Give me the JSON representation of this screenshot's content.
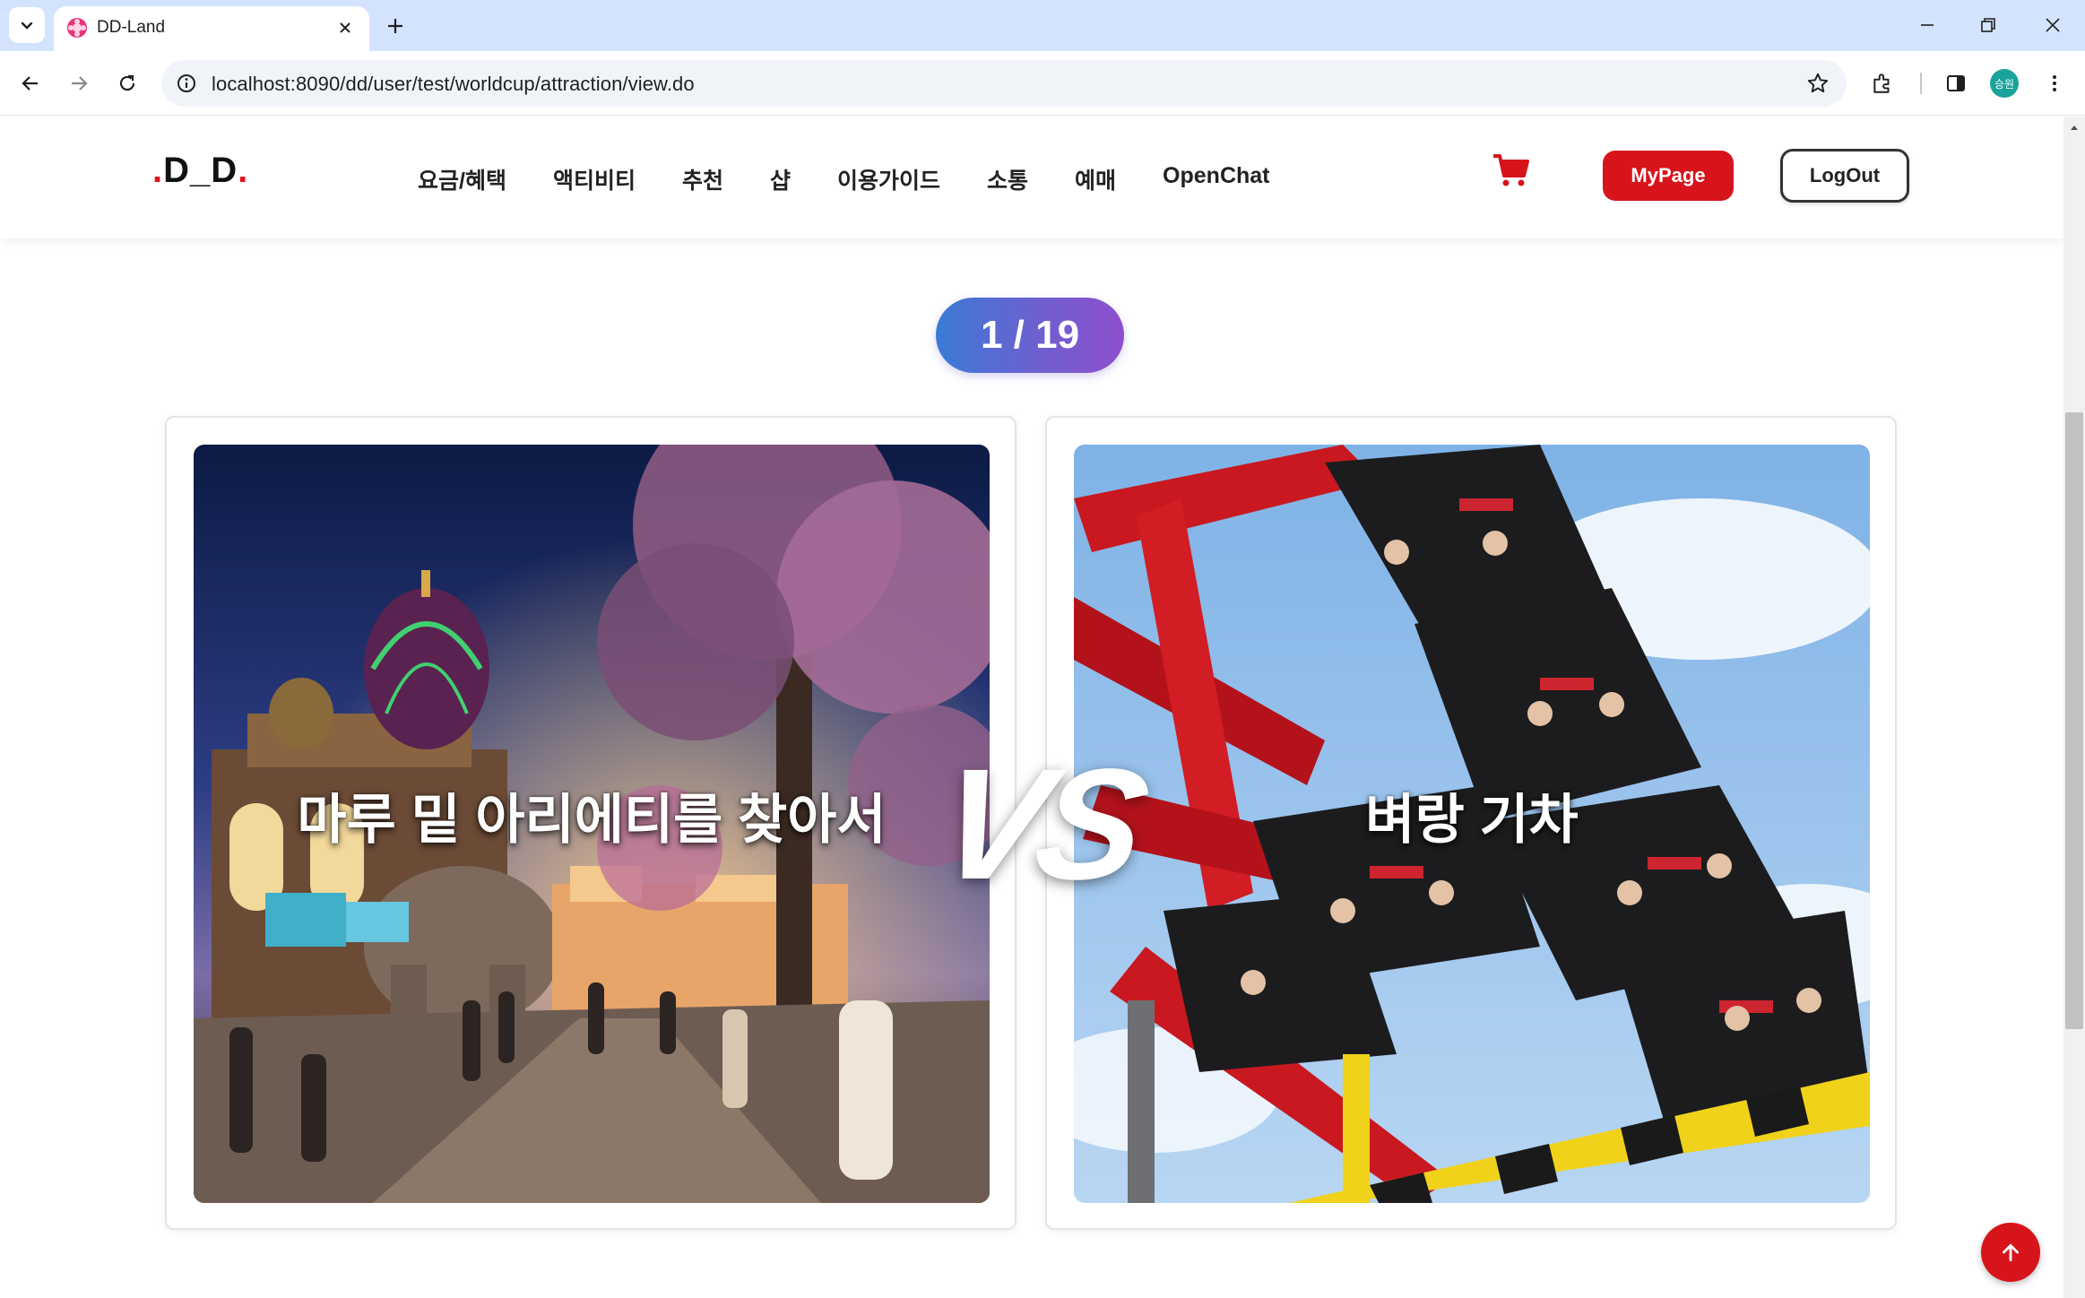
{
  "browser": {
    "tab_title": "DD-Land",
    "url": "localhost:8090/dd/user/test/worldcup/attraction/view.do",
    "profile_initials": "승원"
  },
  "site": {
    "logo_main": "D_D",
    "nav": [
      "요금/혜택",
      "액티비티",
      "추천",
      "샵",
      "이용가이드",
      "소통",
      "예매",
      "OpenChat"
    ],
    "mypage_label": "MyPage",
    "logout_label": "LogOut",
    "accent_color": "#d7141b"
  },
  "worldcup": {
    "round": "1 / 19",
    "vs": "VS",
    "left_label": "마루 밑 아리에티를 찾아서",
    "right_label": "벼랑 기차"
  },
  "icons": [
    "tab-search-icon",
    "close-icon",
    "plus-icon",
    "minimize-icon",
    "restore-icon",
    "back-icon",
    "forward-icon",
    "reload-icon",
    "info-icon",
    "star-icon",
    "extensions-icon",
    "sidepanel-icon",
    "more-icon",
    "cart-icon",
    "arrow-up-icon"
  ]
}
